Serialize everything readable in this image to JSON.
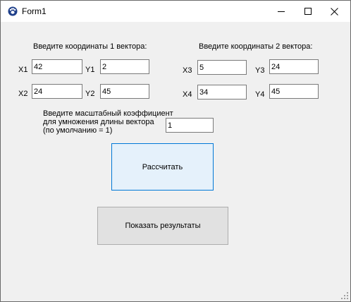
{
  "window": {
    "title": "Form1",
    "icon": "app-icon",
    "controls": [
      "minimize-icon",
      "maximize-icon",
      "close-icon"
    ]
  },
  "vector1": {
    "heading": "Введите координаты 1 вектора:",
    "x1_label": "X1",
    "x1_value": "42",
    "y1_label": "Y1",
    "y1_value": "2",
    "x2_label": "X2",
    "x2_value": "24",
    "y2_label": "Y2",
    "y2_value": "45"
  },
  "vector2": {
    "heading": "Введите координаты 2 вектора:",
    "x3_label": "X3",
    "x3_value": "5",
    "y3_label": "Y3",
    "y3_value": "24",
    "x4_label": "X4",
    "x4_value": "34",
    "y4_label": "Y4",
    "y4_value": "45"
  },
  "scale": {
    "label": "Введите масштабный коэффициент\nдля умножения длины вектора\n(по умолчанию = 1)",
    "value": "1"
  },
  "buttons": {
    "calculate": "Рассчитать",
    "show_results": "Показать результаты"
  }
}
